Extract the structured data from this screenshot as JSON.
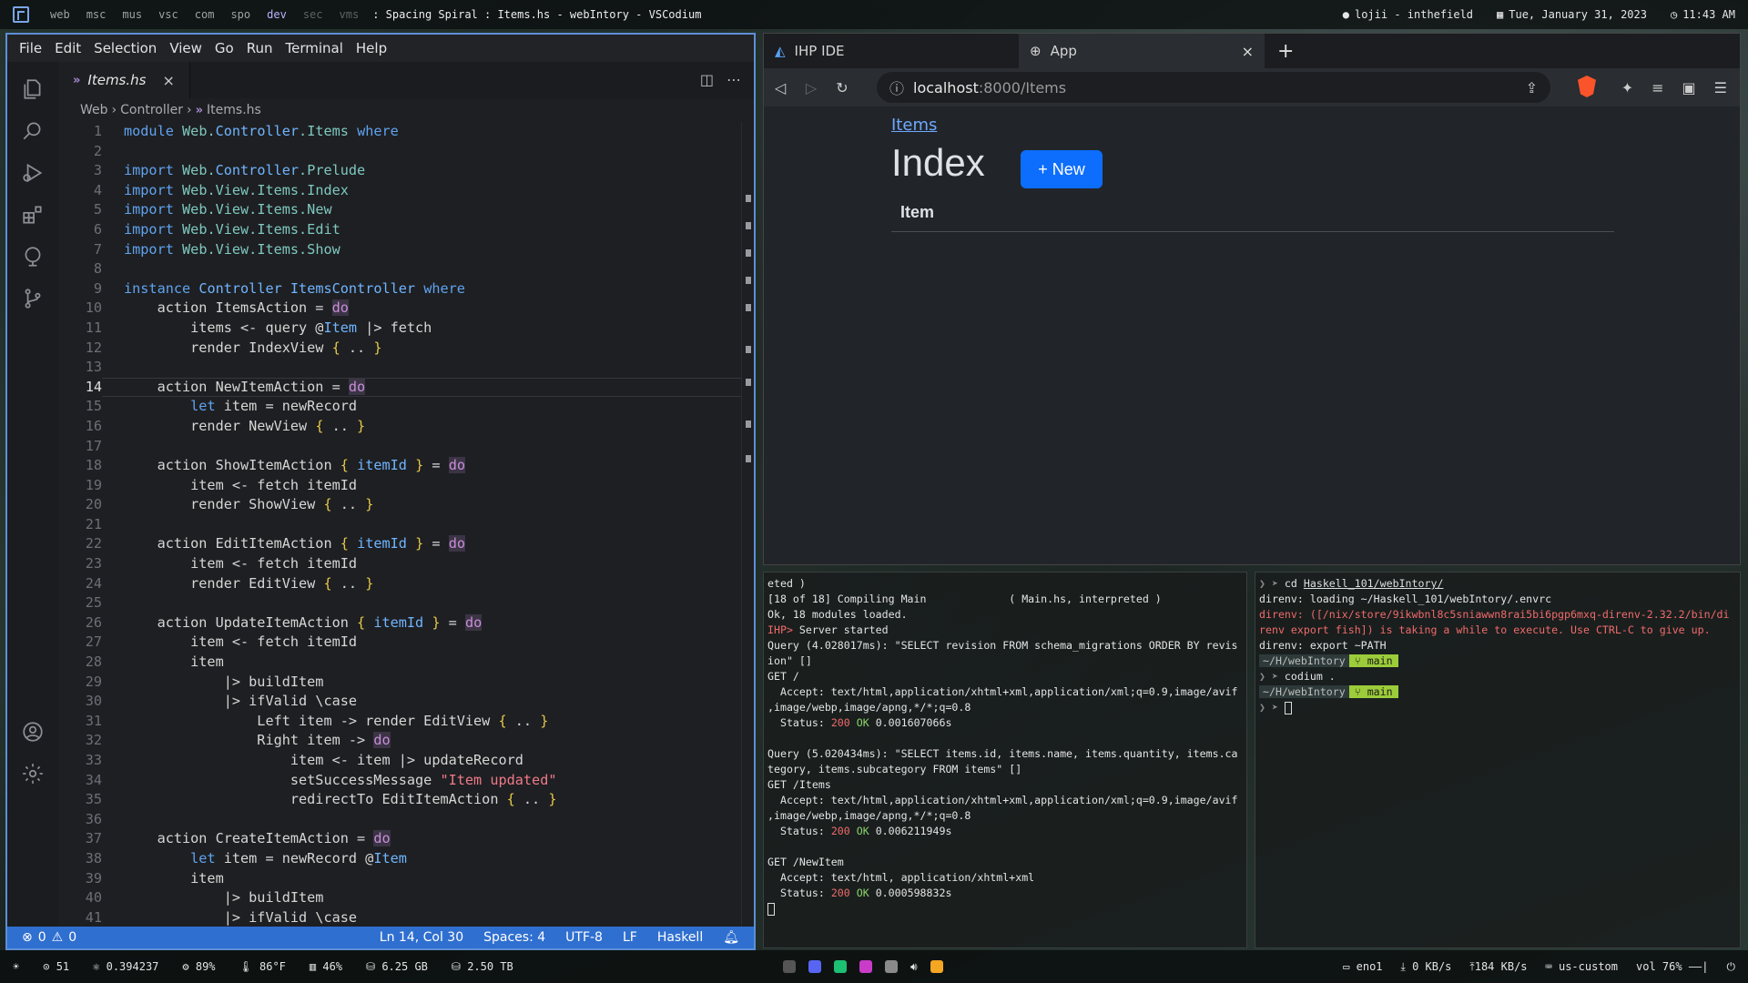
{
  "topbar": {
    "workspaces": [
      "web",
      "msc",
      "mus",
      "vsc",
      "com",
      "spo",
      "dev",
      "sec",
      "vms"
    ],
    "window_title": ": Spacing Spiral :  Items.hs - webIntory - VSCodium",
    "user": "lojii - inthefield",
    "date": "Tue, January 31, 2023",
    "time": "11:43 AM"
  },
  "vscode": {
    "menu": [
      "File",
      "Edit",
      "Selection",
      "View",
      "Go",
      "Run",
      "Terminal",
      "Help"
    ],
    "tab_label": "Items.hs",
    "breadcrumb": [
      "Web",
      "Controller",
      "Items.hs"
    ],
    "status": {
      "problems": "0",
      "warnings": "0",
      "position": "Ln 14, Col 30",
      "spaces": "Spaces: 4",
      "encoding": "UTF-8",
      "eol": "LF",
      "language": "Haskell"
    },
    "code_lines": [
      "module Web.Controller.Items where",
      "",
      "import Web.Controller.Prelude",
      "import Web.View.Items.Index",
      "import Web.View.Items.New",
      "import Web.View.Items.Edit",
      "import Web.View.Items.Show",
      "",
      "instance Controller ItemsController where",
      "    action ItemsAction = do",
      "        items <- query @Item |> fetch",
      "        render IndexView { .. }",
      "",
      "    action NewItemAction = do",
      "        let item = newRecord",
      "        render NewView { .. }",
      "",
      "    action ShowItemAction { itemId } = do",
      "        item <- fetch itemId",
      "        render ShowView { .. }",
      "",
      "    action EditItemAction { itemId } = do",
      "        item <- fetch itemId",
      "        render EditView { .. }",
      "",
      "    action UpdateItemAction { itemId } = do",
      "        item <- fetch itemId",
      "        item",
      "            |> buildItem",
      "            |> ifValid \\case",
      "                Left item -> render EditView { .. }",
      "                Right item -> do",
      "                    item <- item |> updateRecord",
      "                    setSuccessMessage \"Item updated\"",
      "                    redirectTo EditItemAction { .. }",
      "",
      "    action CreateItemAction = do",
      "        let item = newRecord @Item",
      "        item",
      "            |> buildItem",
      "            |> ifValid \\case"
    ]
  },
  "browser": {
    "tabs": [
      "IHP IDE",
      "App"
    ],
    "url_host": "localhost",
    "url_path": ":8000/Items",
    "page": {
      "breadcrumb": "Items",
      "heading": "Index",
      "new_button": "+ New",
      "table_header": "Item"
    }
  },
  "terminal_left": [
    "eted )",
    "[18 of 18] Compiling Main             ( Main.hs, interpreted )",
    "Ok, 18 modules loaded.",
    "IHP> Server started",
    "Query (4.028017ms): \"SELECT revision FROM schema_migrations ORDER BY revis",
    "ion\" []",
    "GET /",
    "  Accept: text/html,application/xhtml+xml,application/xml;q=0.9,image/avif",
    ",image/webp,image/apng,*/*;q=0.8",
    "  Status: 200 OK 0.001607066s",
    "",
    "Query (5.020434ms): \"SELECT items.id, items.name, items.quantity, items.ca",
    "tegory, items.subcategory FROM items\" []",
    "GET /Items",
    "  Accept: text/html,application/xhtml+xml,application/xml;q=0.9,image/avif",
    ",image/webp,image/apng,*/*;q=0.8",
    "  Status: 200 OK 0.006211949s",
    "",
    "GET /NewItem",
    "  Accept: text/html, application/xhtml+xml",
    "  Status: 200 OK 0.000598832s"
  ],
  "terminal_right": {
    "cd_cmd": "cd",
    "cd_path": "Haskell_101/webIntory/",
    "direnv_loading": "direnv: loading ~/Haskell_101/webIntory/.envrc",
    "direnv_warn1": "direnv: ([/nix/store/9ikwbnl8c5sniawwn8rai5bi6pgp6mxq-direnv-2.32.2/bin/di",
    "direnv_warn2": "renv export fish]) is taking a while to execute. Use CTRL-C to give up.",
    "direnv_export": "direnv: export ~PATH",
    "prompt_dir": "~/H/webIntory",
    "prompt_branch": "main",
    "codium_cmd": "codium ."
  },
  "bottombar": {
    "left": [
      "51",
      "0.394237",
      "89%",
      "86°F",
      "46%",
      "6.25 GB",
      "2.50 TB"
    ],
    "right": [
      "eno1",
      "0 KB/s",
      "184 KB/s",
      "us-custom",
      "vol 76%"
    ]
  }
}
